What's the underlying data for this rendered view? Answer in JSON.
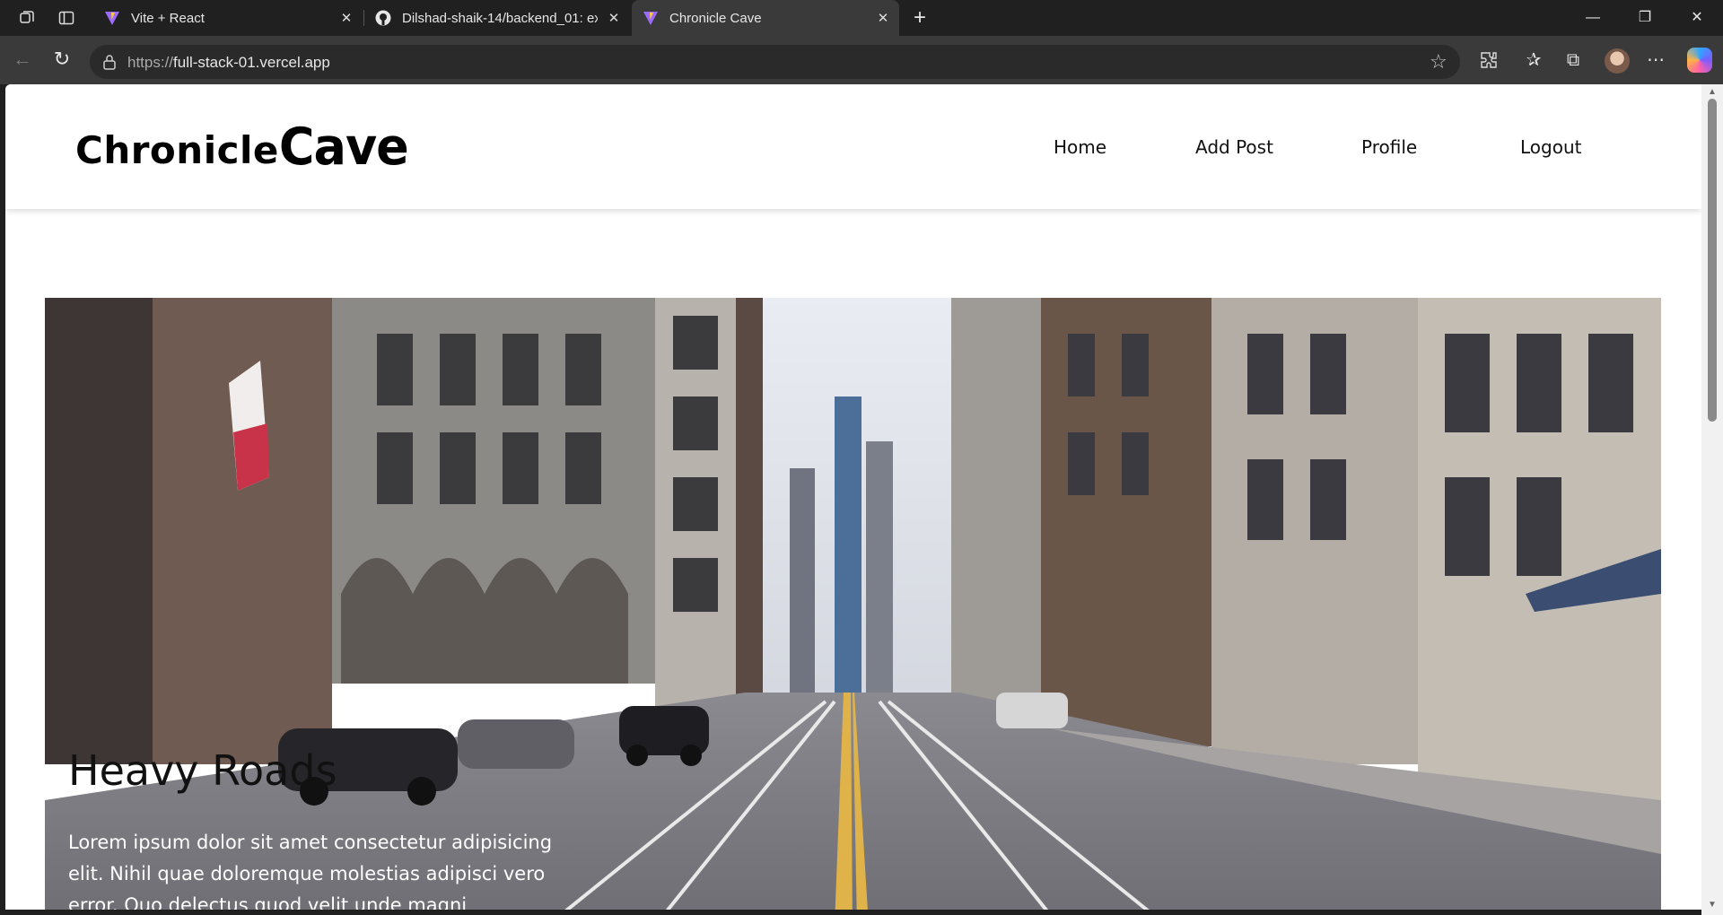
{
  "browser": {
    "tabs": [
      {
        "title": "Vite + React",
        "icon": "vite-icon"
      },
      {
        "title": "Dilshad-shaik-14/backend_01: exp",
        "icon": "github-icon"
      },
      {
        "title": "Chronicle Cave",
        "icon": "vite-icon",
        "active": true
      }
    ],
    "address": {
      "scheme": "https://",
      "host": "full-stack-01.vercel.app"
    }
  },
  "site": {
    "logo": {
      "part1": "Chronicle",
      "part2": "Cave"
    },
    "nav": [
      "Home",
      "Add Post",
      "Profile",
      "Logout"
    ]
  },
  "hero": {
    "title": "Heavy Roads",
    "text": "Lorem ipsum dolor sit amet consectetur adipisicing elit. Nihil quae doloremque molestias adipisci vero error. Quo delectus quod velit unde magni"
  },
  "colors": {
    "page_bg": "#ffffff",
    "chrome_bg": "#202020",
    "toolbar_bg": "#3a3a3a"
  }
}
